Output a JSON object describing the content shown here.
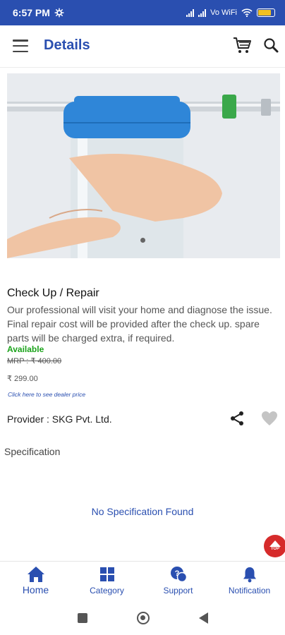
{
  "status_bar": {
    "time": "6:57 PM",
    "network": "Vo WiFi"
  },
  "app_bar": {
    "title": "Details"
  },
  "product": {
    "title": "Check Up / Repair",
    "description": "Our professional will visit your home and diagnose the issue. Final repair cost will be provided after the check up. spare parts will be charged extra, if required.",
    "availability": "Available",
    "mrp": "MRP : ₹ 400.00",
    "price": "₹ 299.00",
    "dealer_link": "Click here to see dealer price",
    "provider": "Provider : SKG Pvt. Ltd."
  },
  "specification": {
    "heading": "Specification",
    "empty_message": "No Specification Found"
  },
  "scroll_top": {
    "label": "TOP"
  },
  "bottom_nav": [
    {
      "label": "Home",
      "icon": "home-icon"
    },
    {
      "label": "Category",
      "icon": "grid-icon"
    },
    {
      "label": "Support",
      "icon": "support-icon"
    },
    {
      "label": "Notification",
      "icon": "bell-icon"
    }
  ],
  "colors": {
    "primary": "#2a4fb0",
    "available": "#1aa31a",
    "scroll_top": "#d62b2b"
  }
}
